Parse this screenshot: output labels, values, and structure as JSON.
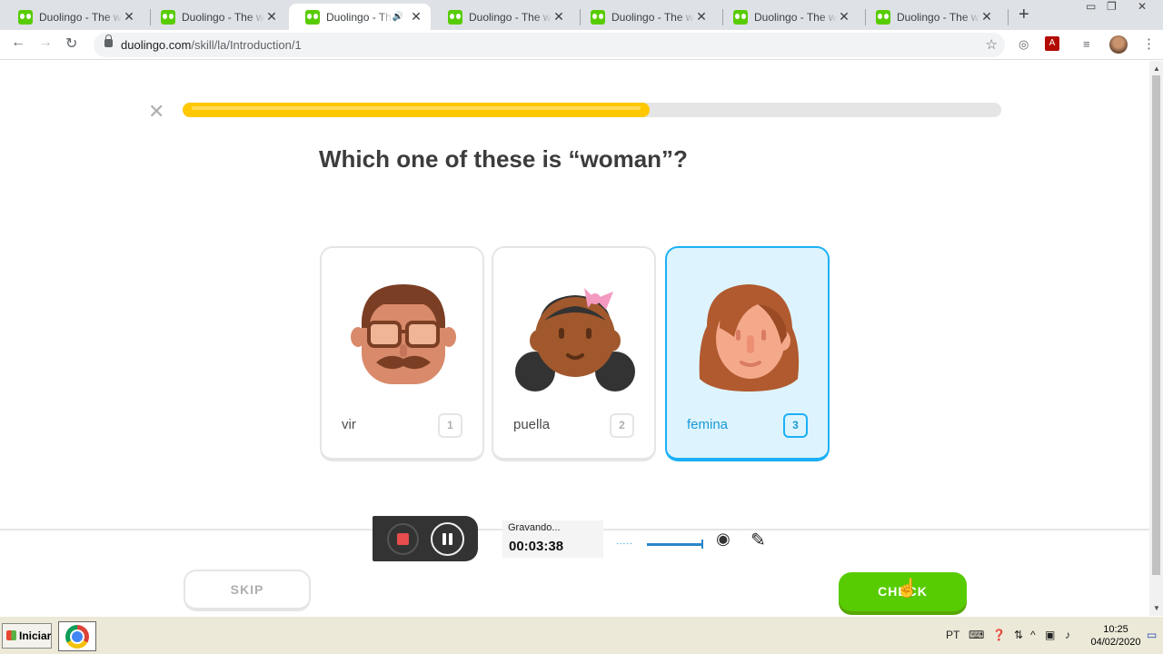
{
  "browser": {
    "tabs": [
      {
        "title": "Duolingo - The world's best way to learn"
      },
      {
        "title": "Duolingo - The world's best way to learn"
      },
      {
        "title": "Duolingo - The world's best way to learn"
      },
      {
        "title": "Duolingo - The world's best way to learn"
      },
      {
        "title": "Duolingo - The world's best way to learn"
      },
      {
        "title": "Duolingo - The world's best way to learn"
      },
      {
        "title": "Duolingo - The world's best way to learn"
      }
    ],
    "active_tab": 2,
    "url_host": "duolingo.com",
    "url_path": "/skill/la/Introduction/1"
  },
  "lesson": {
    "progress_fraction": 0.57,
    "question": "Which one of these is “woman”?",
    "choices": [
      {
        "label": "vir",
        "number": "1",
        "selected": false
      },
      {
        "label": "puella",
        "number": "2",
        "selected": false
      },
      {
        "label": "femina",
        "number": "3",
        "selected": true
      }
    ],
    "skip_label": "SKIP",
    "check_label": "CHECK"
  },
  "recorder": {
    "status": "Gravando...",
    "elapsed": "00:03:38",
    "dots": "....."
  },
  "taskbar": {
    "start_label": "Iniciar",
    "language": "PT",
    "time": "10:25",
    "date": "04/02/2020"
  },
  "colors": {
    "progress": "#ffc800",
    "check": "#58cc02",
    "selected_border": "#1cb0f6",
    "selected_bg": "#ddf4ff"
  }
}
